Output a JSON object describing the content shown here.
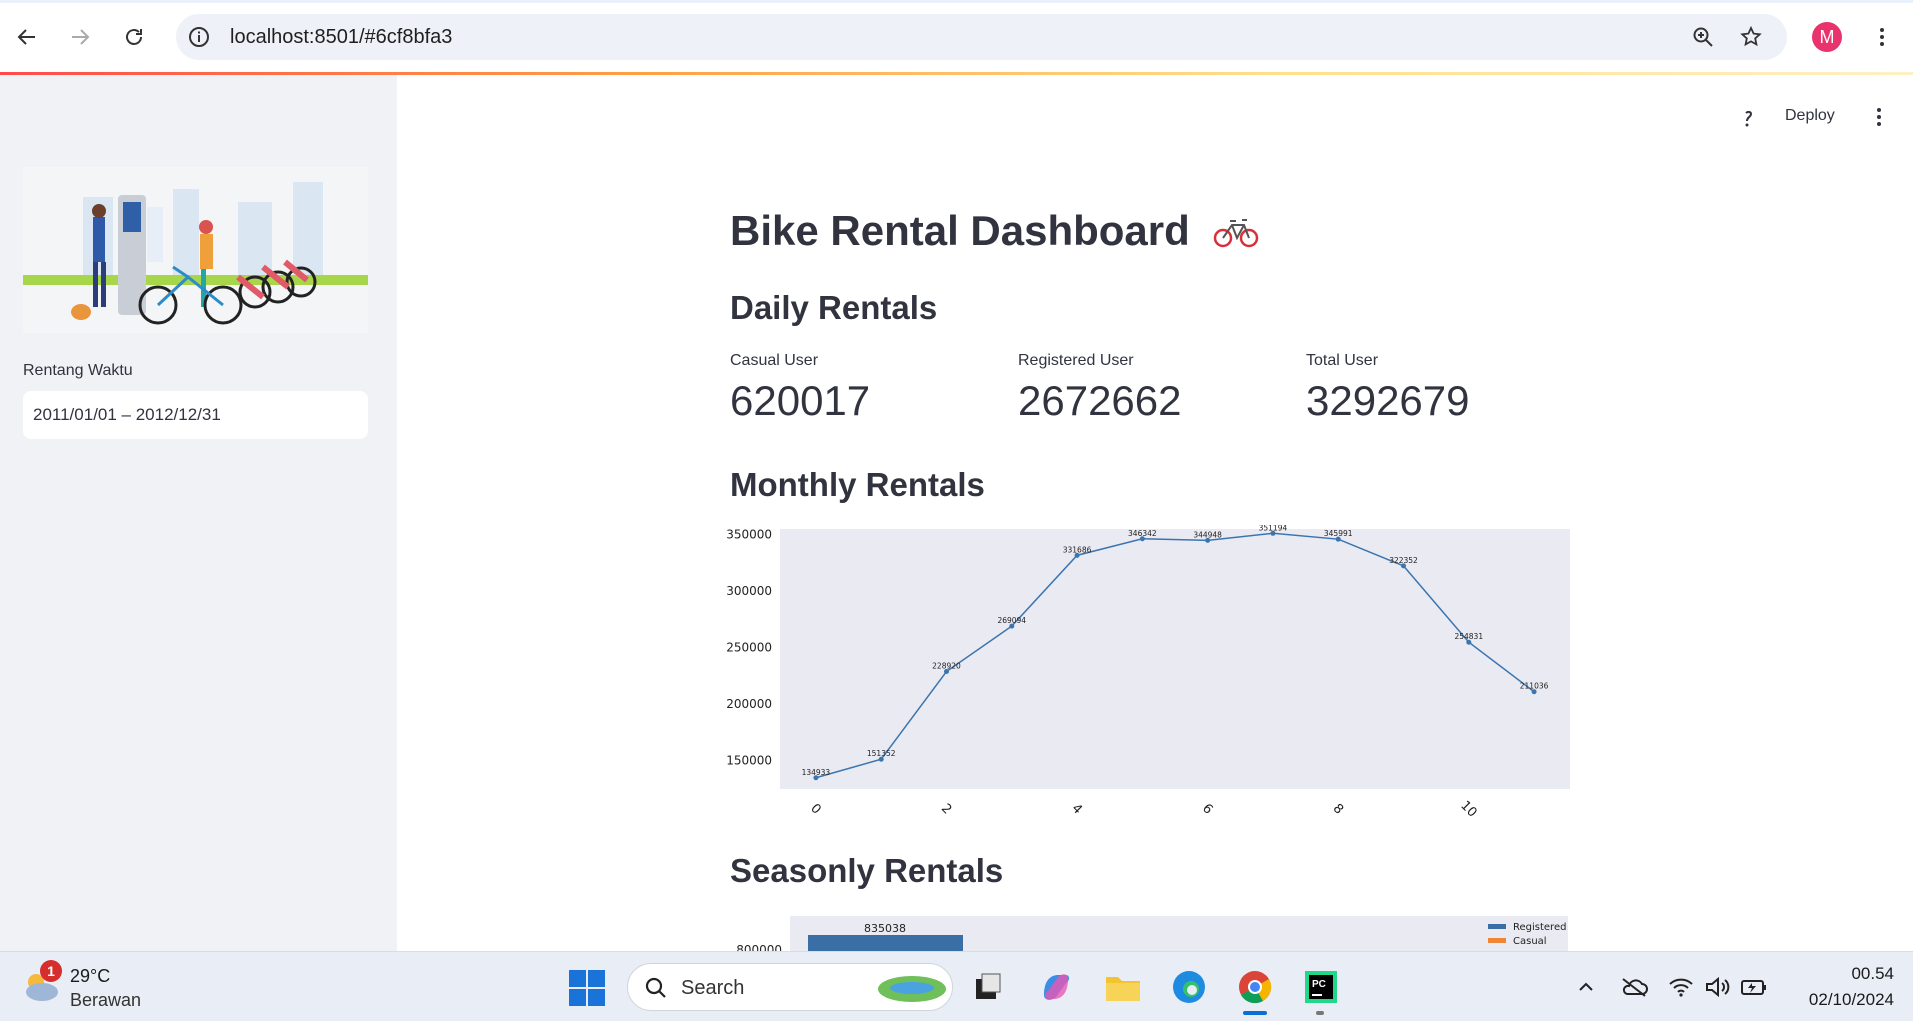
{
  "browser": {
    "url": "localhost:8501/#6cf8bfa3",
    "profile_initial": "M",
    "profile_color": "#e8336d"
  },
  "sidebar": {
    "date_label": "Rentang Waktu",
    "date_value": "2011/01/01 – 2012/12/31"
  },
  "toolbar": {
    "deploy_label": "Deploy"
  },
  "page": {
    "title": "Bike Rental Dashboard",
    "daily_heading": "Daily Rentals",
    "monthly_heading": "Monthly Rentals",
    "seasonly_heading": "Seasonly Rentals"
  },
  "metrics": [
    {
      "label": "Casual User",
      "value": "620017"
    },
    {
      "label": "Registered User",
      "value": "2672662"
    },
    {
      "label": "Total User",
      "value": "3292679"
    }
  ],
  "chart_data": [
    {
      "type": "line",
      "x": [
        0,
        1,
        2,
        3,
        4,
        5,
        6,
        7,
        8,
        9,
        10,
        11
      ],
      "values": [
        134933,
        151352,
        228920,
        269094,
        331686,
        346342,
        344948,
        351194,
        345991,
        322352,
        254831,
        211036
      ],
      "data_labels": [
        "134933",
        "151352",
        "228920",
        "269094",
        "331686",
        "346342",
        "344948",
        "351194",
        "345991",
        "322352",
        "254831",
        "211036"
      ],
      "xticks": [
        "0",
        "2",
        "4",
        "6",
        "8",
        "10"
      ],
      "yticks": [
        "150000",
        "200000",
        "250000",
        "300000",
        "350000"
      ],
      "ylim": [
        125000,
        355000
      ],
      "xlim": [
        -0.55,
        11.55
      ],
      "line_color": "#3b75af",
      "background": "#eaeaf2"
    },
    {
      "type": "bar",
      "series": [
        {
          "name": "Registered",
          "color": "#3a6fa5"
        },
        {
          "name": "Casual",
          "color": "#ee8635"
        }
      ],
      "visible_bar_label": "835038",
      "visible_ytick": "800000",
      "background": "#eaeaf2"
    }
  ],
  "taskbar": {
    "weather_badge": "1",
    "temperature": "29°C",
    "weather_desc": "Berawan",
    "search_label": "Search",
    "time": "00.54",
    "date": "02/10/2024"
  }
}
